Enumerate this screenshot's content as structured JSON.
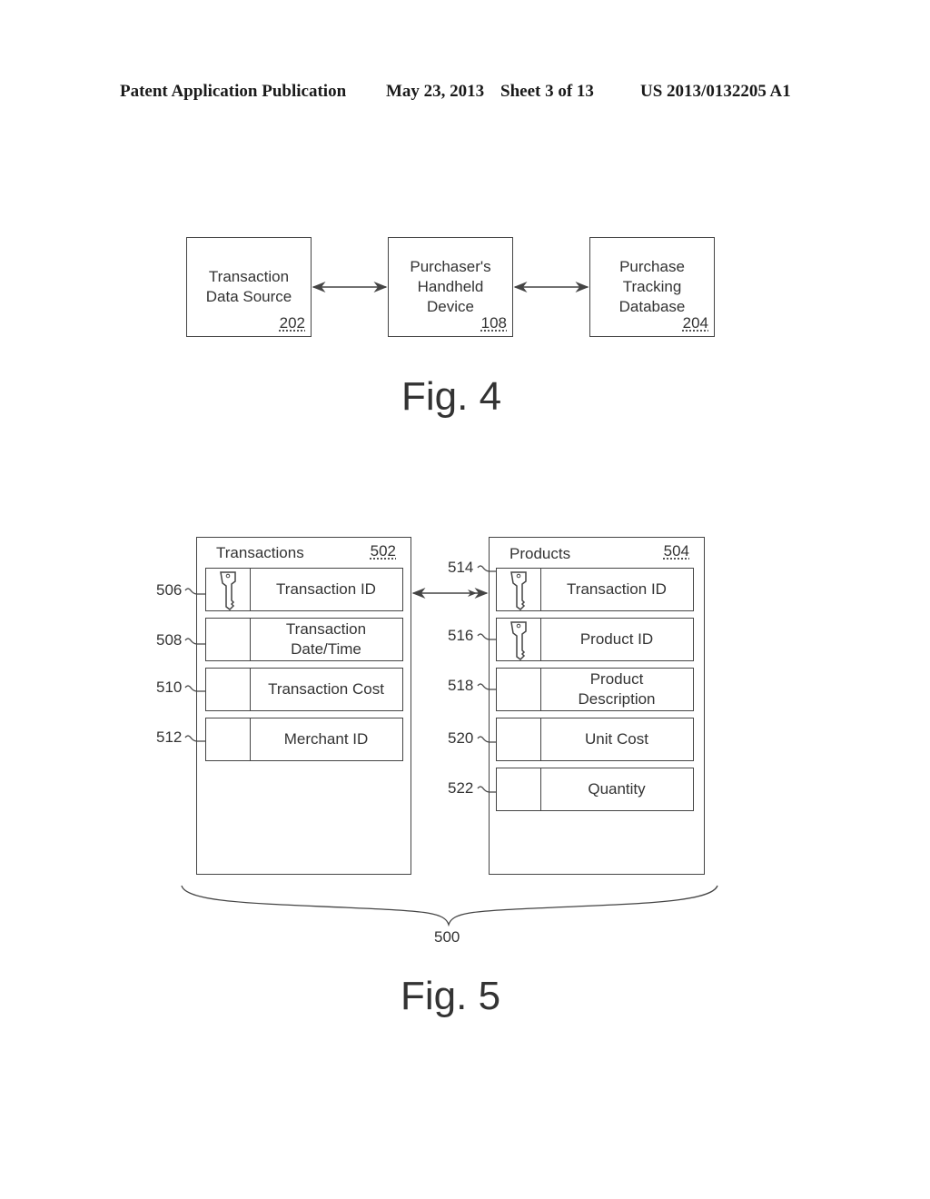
{
  "header": {
    "publication": "Patent Application Publication",
    "date": "May 23, 2013",
    "sheet": "Sheet 3 of 13",
    "number": "US 2013/0132205 A1"
  },
  "fig4": {
    "label": "Fig. 4",
    "boxes": [
      {
        "lines": [
          "Transaction",
          "Data Source"
        ],
        "ref": "202"
      },
      {
        "lines": [
          "Purchaser's",
          "Handheld",
          "Device"
        ],
        "ref": "108"
      },
      {
        "lines": [
          "Purchase",
          "Tracking",
          "Database"
        ],
        "ref": "204"
      }
    ],
    "connections": [
      {
        "from": "202",
        "to": "108",
        "type": "bidirectional"
      },
      {
        "from": "108",
        "to": "204",
        "type": "bidirectional"
      }
    ]
  },
  "fig5": {
    "label": "Fig. 5",
    "group_ref": "500",
    "tables": [
      {
        "title": "Transactions",
        "ref": "502",
        "fields": [
          {
            "ref": "506",
            "lines": [
              "Transaction ID"
            ],
            "key": true
          },
          {
            "ref": "508",
            "lines": [
              "Transaction",
              "Date/Time"
            ],
            "key": false
          },
          {
            "ref": "510",
            "lines": [
              "Transaction Cost"
            ],
            "key": false
          },
          {
            "ref": "512",
            "lines": [
              "Merchant ID"
            ],
            "key": false
          }
        ]
      },
      {
        "title": "Products",
        "ref": "504",
        "fields": [
          {
            "ref": "514",
            "lines": [
              "Transaction ID"
            ],
            "key": true
          },
          {
            "ref": "516",
            "lines": [
              "Product ID"
            ],
            "key": true
          },
          {
            "ref": "518",
            "lines": [
              "Product",
              "Description"
            ],
            "key": false
          },
          {
            "ref": "520",
            "lines": [
              "Unit Cost"
            ],
            "key": false
          },
          {
            "ref": "522",
            "lines": [
              "Quantity"
            ],
            "key": false
          }
        ]
      }
    ],
    "relationship": {
      "from": "506",
      "to": "514",
      "type": "bidirectional"
    }
  }
}
